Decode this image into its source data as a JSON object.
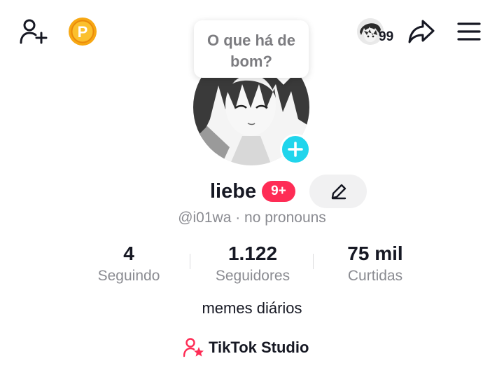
{
  "header": {
    "story_count": "99",
    "icons": {
      "add_friend": "add-friend-icon",
      "coin": "coin-icon",
      "share": "share-icon",
      "menu": "menu-icon"
    },
    "coin_letter": "P"
  },
  "bubble": {
    "text": "O que há de bom?"
  },
  "profile": {
    "name": "liebe",
    "badge": "9+",
    "handle_line": "@i01wa · no pronouns",
    "bio": "memes diários"
  },
  "stats": [
    {
      "value": "4",
      "label": "Seguindo"
    },
    {
      "value": "1.122",
      "label": "Seguidores"
    },
    {
      "value": "75 mil",
      "label": "Curtidas"
    }
  ],
  "studio": {
    "label": "TikTok Studio"
  },
  "colors": {
    "accent_pink": "#fe2c55",
    "accent_cyan": "#20d5ec",
    "coin_gold": "#f7a813",
    "secondary_text": "#8a8b91",
    "button_bg": "#f1f1f2"
  }
}
